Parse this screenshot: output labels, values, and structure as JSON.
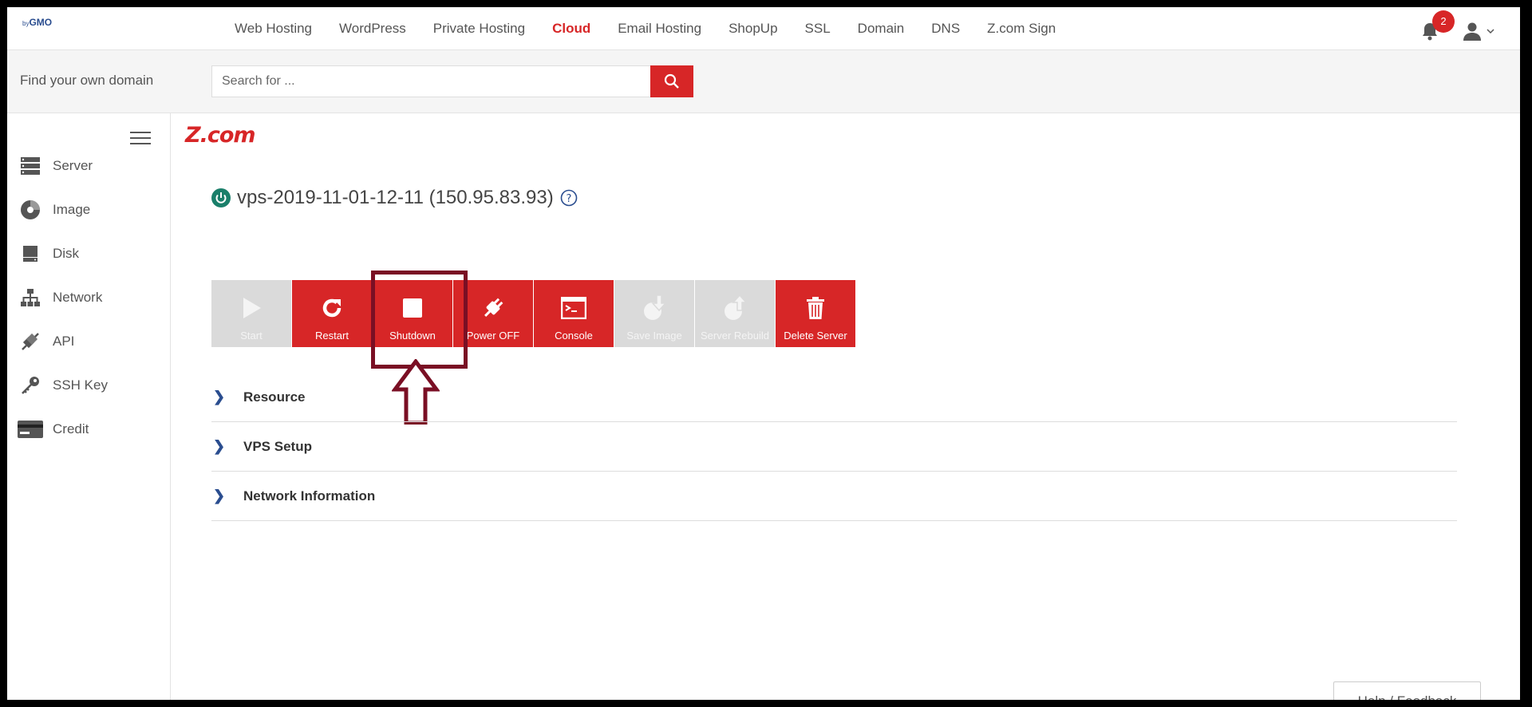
{
  "brand": {
    "logo_main": "Z.com",
    "logo_by": "by",
    "logo_gmo": "GMO"
  },
  "topnav": {
    "items": [
      {
        "label": "Web Hosting"
      },
      {
        "label": "WordPress"
      },
      {
        "label": "Private Hosting"
      },
      {
        "label": "Cloud",
        "active": true
      },
      {
        "label": "Email Hosting"
      },
      {
        "label": "ShopUp"
      },
      {
        "label": "SSL"
      },
      {
        "label": "Domain"
      },
      {
        "label": "DNS"
      },
      {
        "label": "Z.com Sign"
      }
    ],
    "notification_count": "2"
  },
  "search": {
    "label": "Find your own domain",
    "placeholder": "Search for ..."
  },
  "sidebar": {
    "items": [
      {
        "label": "Server",
        "icon": "server-icon"
      },
      {
        "label": "Image",
        "icon": "image-icon"
      },
      {
        "label": "Disk",
        "icon": "disk-icon"
      },
      {
        "label": "Network",
        "icon": "network-icon"
      },
      {
        "label": "API",
        "icon": "api-icon"
      },
      {
        "label": "SSH Key",
        "icon": "key-icon"
      },
      {
        "label": "Credit",
        "icon": "credit-card-icon"
      }
    ]
  },
  "vps": {
    "title": "vps-2019-11-01-12-11 (150.95.83.93)",
    "status": "running"
  },
  "actions": [
    {
      "label": "Start",
      "enabled": false,
      "icon": "play-icon"
    },
    {
      "label": "Restart",
      "enabled": true,
      "icon": "restart-icon"
    },
    {
      "label": "Shutdown",
      "enabled": true,
      "icon": "stop-icon"
    },
    {
      "label": "Power OFF",
      "enabled": true,
      "icon": "plug-icon"
    },
    {
      "label": "Console",
      "enabled": true,
      "icon": "console-icon"
    },
    {
      "label": "Save Image",
      "enabled": false,
      "icon": "save-image-icon"
    },
    {
      "label": "Server Rebuild",
      "enabled": false,
      "icon": "rebuild-icon"
    },
    {
      "label": "Delete Server",
      "enabled": true,
      "icon": "trash-icon"
    }
  ],
  "sections": [
    {
      "label": "Resource"
    },
    {
      "label": "VPS Setup"
    },
    {
      "label": "Network Information"
    }
  ],
  "help": {
    "label": "Help / Feedback"
  },
  "colors": {
    "accent": "#d72627",
    "annotation": "#7a0f24",
    "link": "#2a4d8f",
    "power_green": "#1a7f6a"
  }
}
